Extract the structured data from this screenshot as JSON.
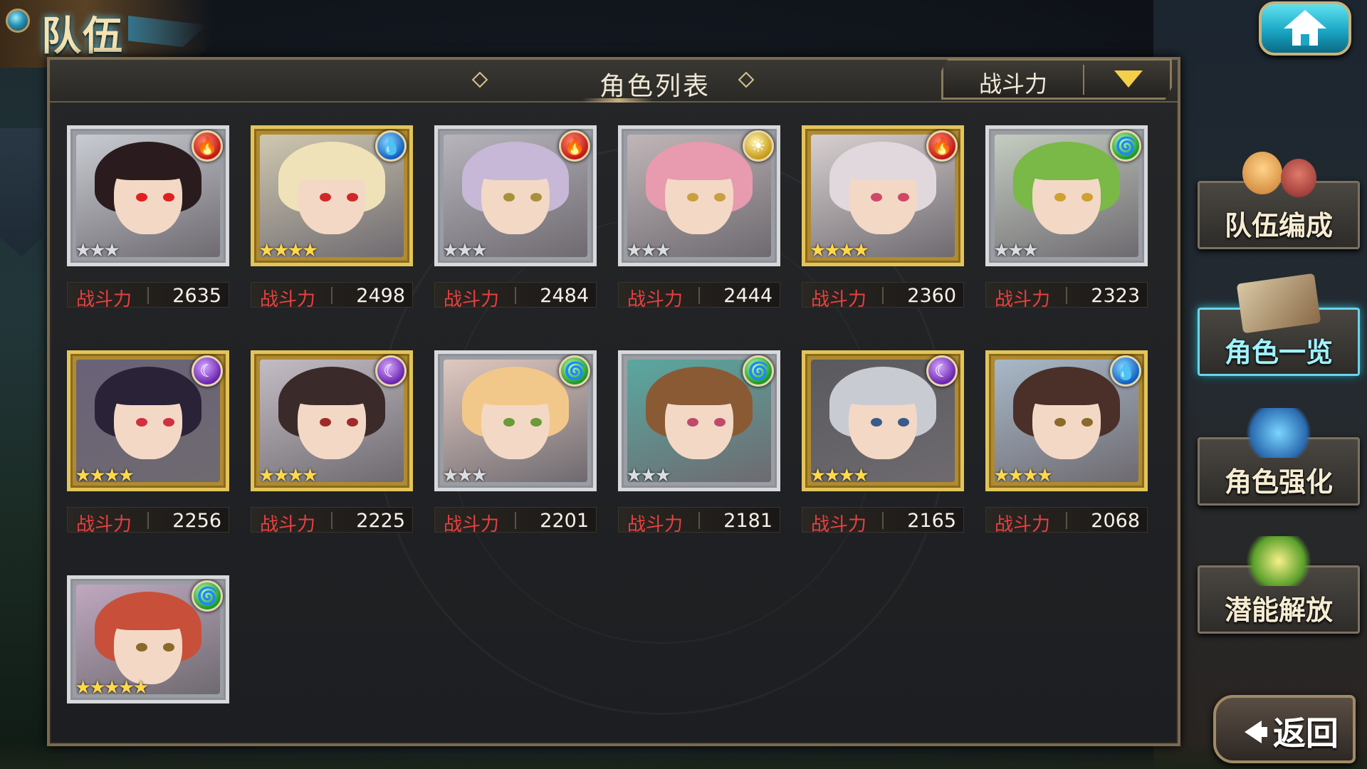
{
  "screen": {
    "title": "队伍"
  },
  "panel": {
    "title": "角色列表",
    "sort": {
      "selected": "战斗力"
    }
  },
  "power_label": "战斗力",
  "characters": [
    {
      "element": "fire",
      "rarity": 3,
      "power": "2635",
      "frame": "silver",
      "hair": "#2a1c1e",
      "eyes": "#e02020",
      "bg": "#c8ccd2"
    },
    {
      "element": "water",
      "rarity": 4,
      "power": "2498",
      "frame": "gold",
      "hair": "#f0e2b8",
      "eyes": "#d02828",
      "bg": "#cfc8b0"
    },
    {
      "element": "fire",
      "rarity": 3,
      "power": "2484",
      "frame": "silver",
      "hair": "#c6b8d6",
      "eyes": "#a8903a",
      "bg": "#b8b4bc"
    },
    {
      "element": "light",
      "rarity": 3,
      "power": "2444",
      "frame": "silver",
      "hair": "#e89aae",
      "eyes": "#c8a040",
      "bg": "#c0b6b8"
    },
    {
      "element": "fire",
      "rarity": 4,
      "power": "2360",
      "frame": "gold",
      "hair": "#e0d8dc",
      "eyes": "#d04868",
      "bg": "#d8d0d0"
    },
    {
      "element": "wind",
      "rarity": 3,
      "power": "2323",
      "frame": "silver",
      "hair": "#7ab848",
      "eyes": "#d0a030",
      "bg": "#c4ccc0"
    },
    {
      "element": "dark",
      "rarity": 4,
      "power": "2256",
      "frame": "gold",
      "hair": "#2a2236",
      "eyes": "#d03040",
      "bg": "#6a6278"
    },
    {
      "element": "dark",
      "rarity": 4,
      "power": "2225",
      "frame": "gold",
      "hair": "#3a2a2a",
      "eyes": "#a02a2a",
      "bg": "#c4bcc4"
    },
    {
      "element": "wind",
      "rarity": 3,
      "power": "2201",
      "frame": "silver",
      "hair": "#f2c88a",
      "eyes": "#6a9a3a",
      "bg": "#e0c8c0"
    },
    {
      "element": "wind",
      "rarity": 3,
      "power": "2181",
      "frame": "silver",
      "hair": "#8a5a34",
      "eyes": "#c04a6a",
      "bg": "#5aa8a0"
    },
    {
      "element": "dark",
      "rarity": 4,
      "power": "2165",
      "frame": "gold",
      "hair": "#c8ccd2",
      "eyes": "#3a5a8a",
      "bg": "#5a5a5e"
    },
    {
      "element": "water",
      "rarity": 4,
      "power": "2068",
      "frame": "gold",
      "hair": "#4a3028",
      "eyes": "#8a6a2a",
      "bg": "#a8b8c8"
    },
    {
      "element": "wind",
      "rarity": 5,
      "power": "",
      "frame": "silver",
      "hair": "#c8503a",
      "eyes": "#8a6a2a",
      "bg": "#c0a8c0"
    }
  ],
  "side_menu": [
    {
      "label": "队伍编成",
      "active": false
    },
    {
      "label": "角色一览",
      "active": true
    },
    {
      "label": "角色强化",
      "active": false
    },
    {
      "label": "潜能解放",
      "active": false
    }
  ],
  "back": {
    "label": "返回"
  },
  "icons": {
    "home": "home-icon",
    "fire": "fire-element-icon",
    "water": "water-element-icon",
    "light": "light-element-icon",
    "dark": "dark-element-icon",
    "wind": "wind-element-icon",
    "sort_dropdown": "chevron-down-icon",
    "back": "arrow-left-icon"
  }
}
